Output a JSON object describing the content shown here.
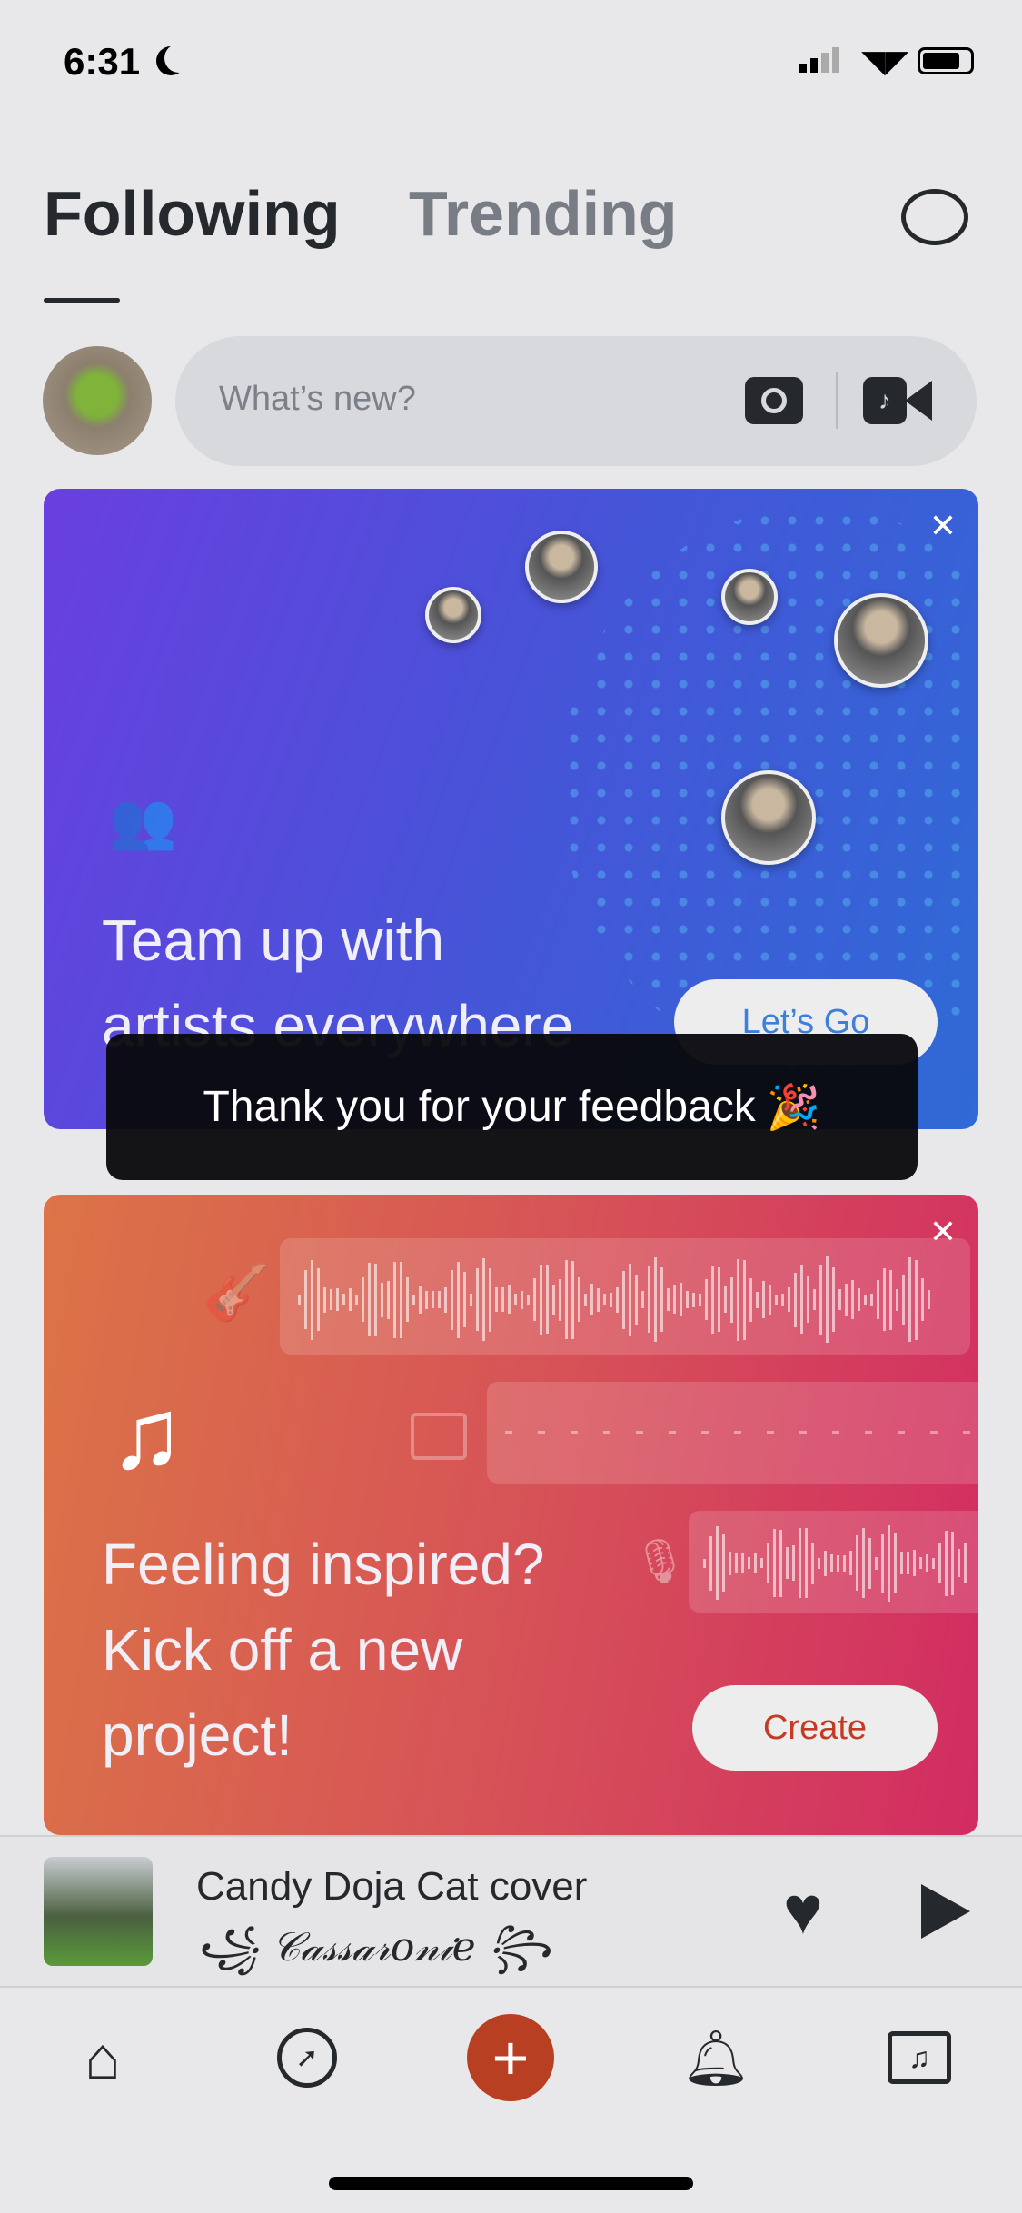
{
  "status_bar": {
    "time": "6:31"
  },
  "header": {
    "tabs": [
      {
        "label": "Following",
        "active": true
      },
      {
        "label": "Trending",
        "active": false
      }
    ]
  },
  "composer": {
    "placeholder": "What’s new?"
  },
  "promo_cards": [
    {
      "title_line1": "Team up with",
      "title_line2": "artists everywhere",
      "button": "Let’s Go"
    },
    {
      "title_lines": [
        "Feeling inspired?",
        "Kick off a new",
        "project!"
      ],
      "button": "Create"
    }
  ],
  "toast": {
    "message": "Thank you for your feedback",
    "emoji": "🎉"
  },
  "mini_player": {
    "title": "Candy Doja Cat cover",
    "artist": "Cassaronie",
    "artist_display": "꧁ 𝒞𝒶𝓈𝓈𝒶𝓇𝑜𝓃𝒾𝑒 ꧂"
  },
  "colors": {
    "accent": "#b83f22",
    "card1_start": "#6a3fe0",
    "card1_end": "#2f6ad6",
    "card2_start": "#dc7447",
    "card2_end": "#d22c62",
    "text": "#25282d"
  }
}
